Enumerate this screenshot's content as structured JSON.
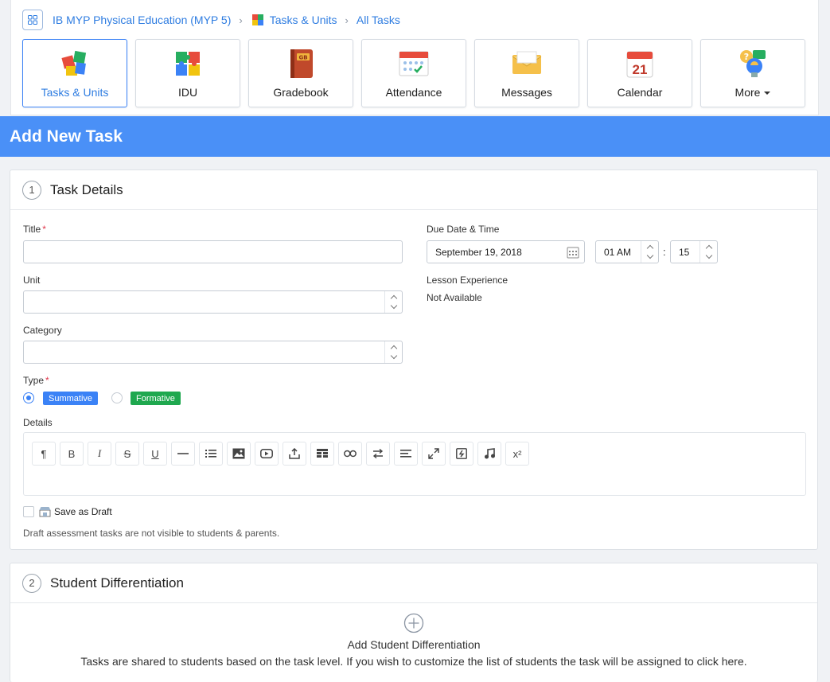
{
  "breadcrumb": {
    "course": "IB MYP Physical Education (MYP 5)",
    "section": "Tasks & Units",
    "current": "All Tasks"
  },
  "tiles": [
    {
      "label": "Tasks & Units",
      "icon": "puzzle-icon",
      "active": true
    },
    {
      "label": "IDU",
      "icon": "puzzle-pieces-icon"
    },
    {
      "label": "Gradebook",
      "icon": "gradebook-icon"
    },
    {
      "label": "Attendance",
      "icon": "attendance-icon"
    },
    {
      "label": "Messages",
      "icon": "envelope-icon"
    },
    {
      "label": "Calendar",
      "icon": "calendar-icon",
      "day": "21"
    },
    {
      "label": "More",
      "icon": "help-chat-icon"
    }
  ],
  "page_title": "Add New Task",
  "task_details": {
    "number": "1",
    "title": "Task Details",
    "title_label": "Title",
    "title_value": "",
    "unit_label": "Unit",
    "unit_value": "",
    "category_label": "Category",
    "category_value": "",
    "type_label": "Type",
    "type_options": [
      "Summative",
      "Formative"
    ],
    "type_selected": "Summative",
    "details_label": "Details",
    "due_label": "Due Date & Time",
    "due_date": "September 19, 2018",
    "due_hour": "01 AM",
    "time_sep": ":",
    "due_minute": "15",
    "lesson_label": "Lesson Experience",
    "lesson_value": "Not Available",
    "draft_label": "Save as Draft",
    "draft_help": "Draft assessment tasks are not visible to students & parents.",
    "required_mark": "*"
  },
  "toolbar": {
    "buttons": [
      "paragraph-icon",
      "bold-icon",
      "italic-icon",
      "strikethrough-icon",
      "underline-icon",
      "horizontal-rule-icon",
      "list-icon",
      "image-icon",
      "video-icon",
      "upload-icon",
      "table-icon",
      "link-icon",
      "direction-icon",
      "align-icon",
      "fullscreen-icon",
      "code-icon",
      "audio-icon",
      "superscript-icon"
    ],
    "labels": {
      "bold": "B",
      "italic": "I",
      "strike": "S",
      "underline": "U",
      "superscript": "x²"
    }
  },
  "differentiation": {
    "number": "2",
    "title": "Student Differentiation",
    "add_label": "Add Student Differentiation",
    "description": "Tasks are shared to students based on the task level. If you wish to customize the list of students the task will be assigned to click here."
  },
  "colors": {
    "header_blue": "#4a90f7",
    "link_blue": "#2f7de1",
    "summative": "#3b82f6",
    "formative": "#1fa84f"
  }
}
